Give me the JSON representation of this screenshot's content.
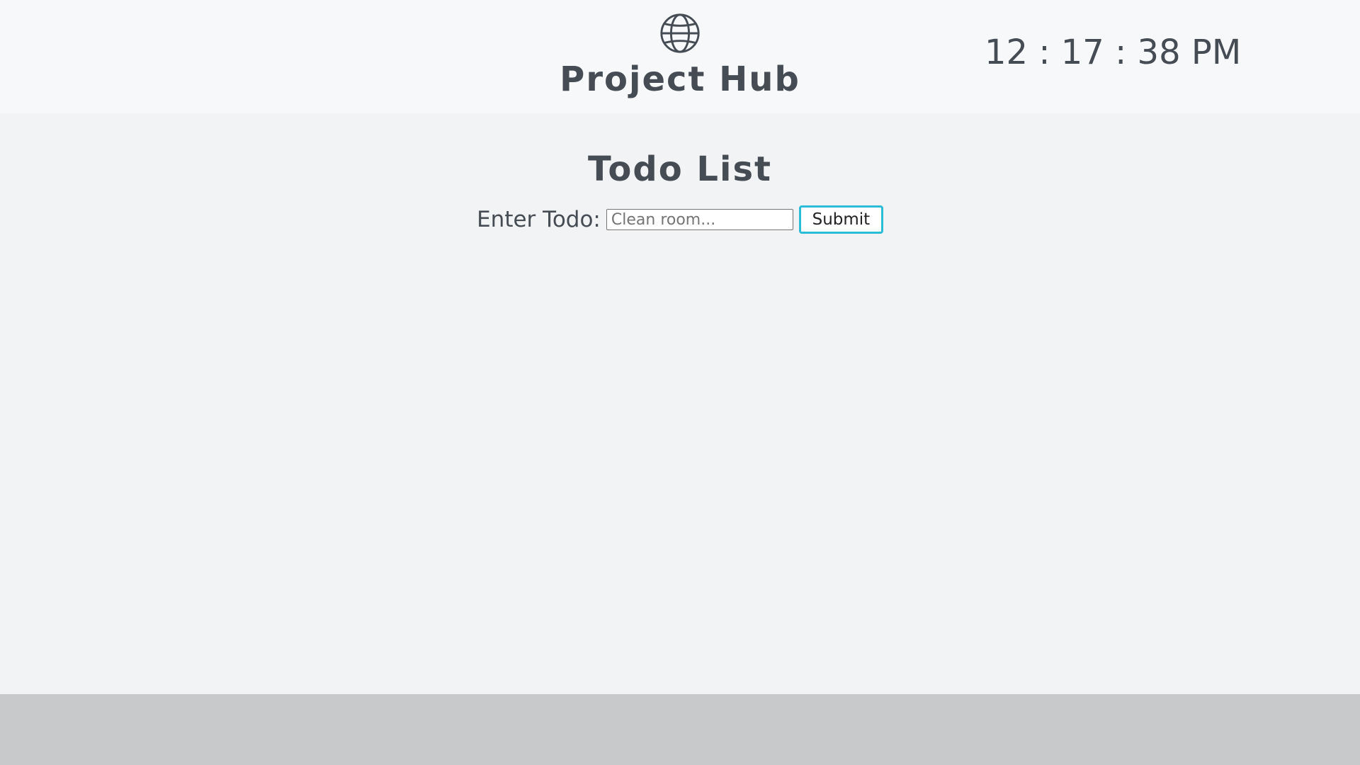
{
  "header": {
    "brand_icon": "globe-icon",
    "brand_title": "Project Hub",
    "clock": "12 : 17 : 38 PM"
  },
  "main": {
    "title": "Todo List",
    "form": {
      "label": "Enter Todo:",
      "input_value": "",
      "input_placeholder": "Clean room...",
      "submit_label": "Submit"
    }
  },
  "colors": {
    "header_bg": "#f7f8fa",
    "main_bg": "#f2f3f5",
    "footer_bg": "#c8c9cb",
    "text": "#454c54",
    "button_border": "#2bbcd8"
  }
}
